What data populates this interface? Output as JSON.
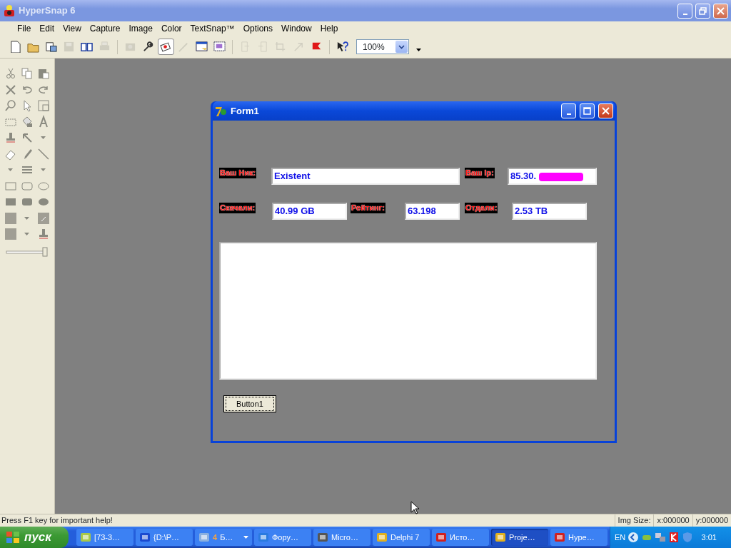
{
  "window": {
    "title": "HyperSnap 6"
  },
  "menu": [
    "File",
    "Edit",
    "View",
    "Capture",
    "Image",
    "Color",
    "TextSnap™",
    "Options",
    "Window",
    "Help"
  ],
  "toolbar": [
    {
      "disabled": false,
      "pressed": false
    },
    {
      "disabled": false,
      "pressed": false
    },
    {
      "disabled": false,
      "pressed": false
    },
    {
      "disabled": true,
      "pressed": false
    },
    {
      "disabled": false,
      "pressed": false
    },
    {
      "disabled": true,
      "pressed": false
    },
    {
      "disabled": true,
      "pressed": false
    },
    {
      "disabled": false,
      "pressed": false
    },
    {
      "disabled": false,
      "pressed": true
    },
    {
      "disabled": true,
      "pressed": false
    },
    {
      "disabled": false,
      "pressed": false
    },
    {
      "disabled": false,
      "pressed": false
    },
    {
      "disabled": true,
      "pressed": false
    },
    {
      "disabled": true,
      "pressed": false
    },
    {
      "disabled": true,
      "pressed": false
    },
    {
      "disabled": true,
      "pressed": false
    },
    {
      "disabled": false,
      "pressed": false
    },
    {
      "disabled": false,
      "pressed": false
    }
  ],
  "zoom": {
    "value": "100%"
  },
  "toolbox": {
    "slider": {
      "level": 1
    }
  },
  "form": {
    "title": "Form1",
    "fields": [
      {
        "label": "Ваш Ник:",
        "value": "Existent",
        "redacted": false
      },
      {
        "label": "Ваш  Ip:",
        "value": "85.30.",
        "redacted": true
      },
      {
        "label": "Скачали:",
        "value": "40.99 GB",
        "redacted": false
      },
      {
        "label": "Рейтинг:",
        "value": "63.198",
        "redacted": false
      },
      {
        "label": "Отдали:",
        "value": "2.53 TB",
        "redacted": false
      }
    ],
    "button": "Button1"
  },
  "status_bar": {
    "message": "Press F1 key for important help!",
    "img_size_label": "Img Size:",
    "x": "x:000000",
    "y": "y:000000"
  },
  "taskbar": {
    "start": "пуск",
    "tasks": [
      {
        "label": "[73-3…",
        "selected": false
      },
      {
        "label": "{D:\\P…",
        "selected": false
      },
      {
        "count": "4",
        "label": "Б…",
        "selected": false
      },
      {
        "label": "Фору…",
        "selected": false
      },
      {
        "label": "Micro…",
        "selected": false
      },
      {
        "label": "Delphi 7",
        "selected": false
      },
      {
        "label": "Исто…",
        "selected": false
      },
      {
        "label": "Proje…",
        "selected": true
      },
      {
        "label": "Hype…",
        "selected": false
      }
    ],
    "language": "EN",
    "clock": "3:01"
  }
}
